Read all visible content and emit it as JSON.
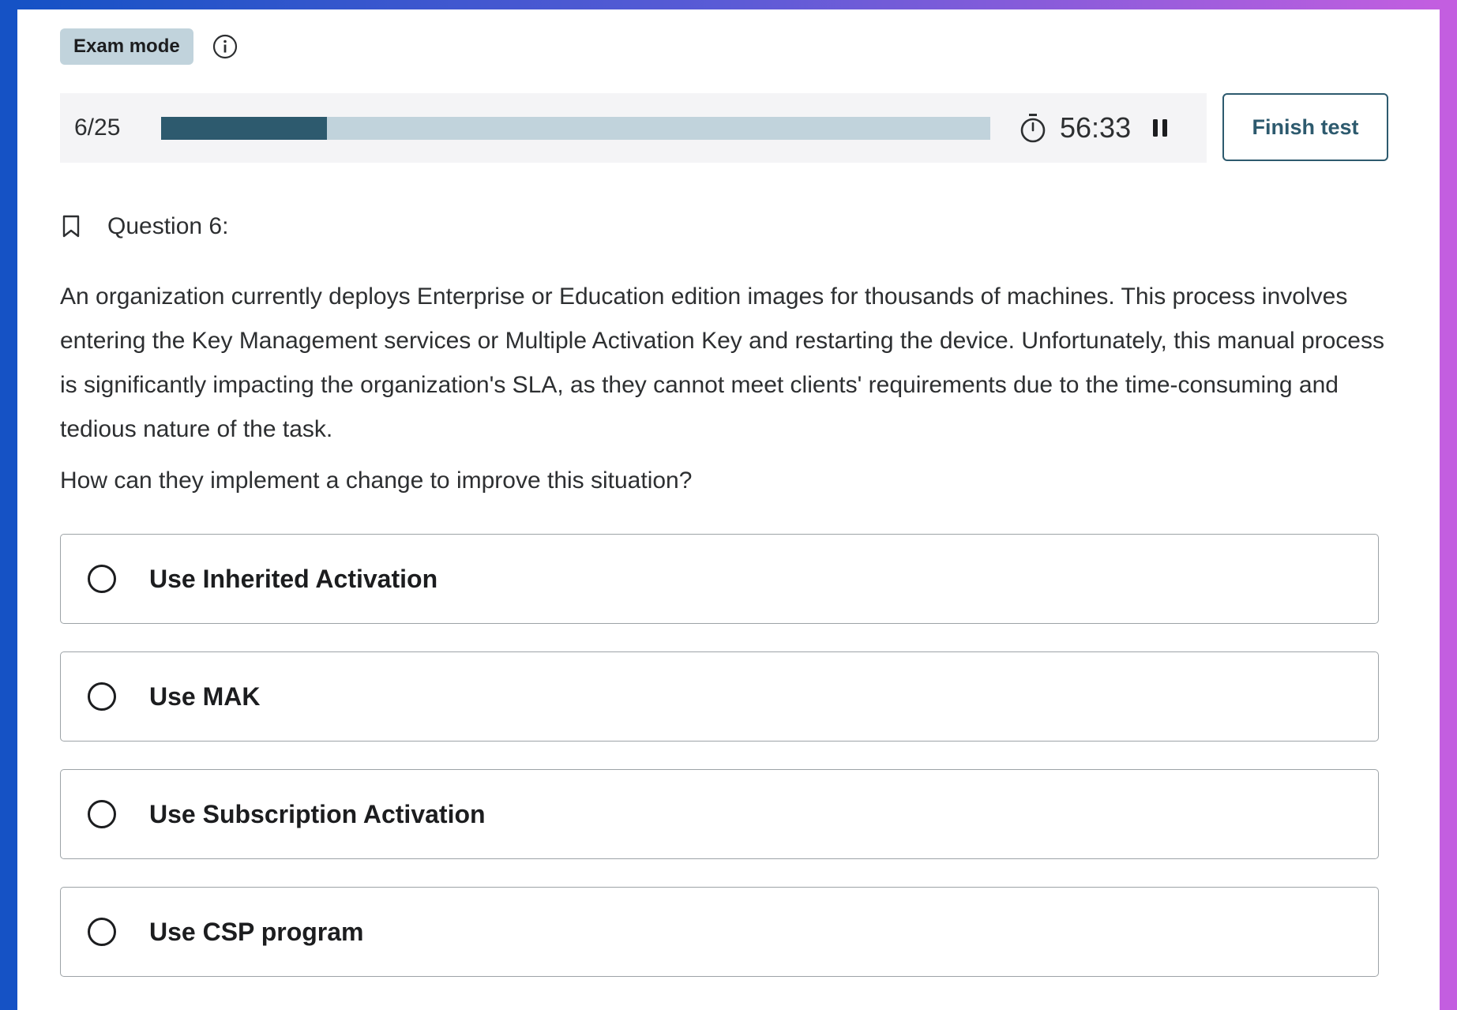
{
  "mode": {
    "badge_label": "Exam mode",
    "info_icon": "info-circle-icon"
  },
  "progress": {
    "count_text": "6/25",
    "current": 6,
    "total": 25,
    "fraction": 0.2
  },
  "timer": {
    "icon": "stopwatch-icon",
    "time_text": "56:33",
    "pause_icon": "pause-icon"
  },
  "finish_button": {
    "label": "Finish test"
  },
  "question": {
    "bookmark_icon": "bookmark-icon",
    "heading": "Question 6:",
    "body": "An organization currently deploys Enterprise or Education edition images for thousands of machines. This process involves entering the Key Management services or Multiple Activation Key and restarting the device. Unfortunately, this manual process is significantly impacting the organization's SLA, as they cannot meet clients' requirements due to the time-consuming and tedious nature of the task.",
    "prompt": "How can they implement a change to improve this situation?"
  },
  "options": [
    {
      "label": "Use Inherited Activation"
    },
    {
      "label": "Use MAK"
    },
    {
      "label": "Use Subscription Activation"
    },
    {
      "label": "Use CSP program"
    }
  ],
  "colors": {
    "accent": "#2d5a6e",
    "track": "#c1d3dc",
    "panel": "#f4f4f6",
    "frame_left": "#1552c5",
    "frame_right": "#c35ee0"
  }
}
